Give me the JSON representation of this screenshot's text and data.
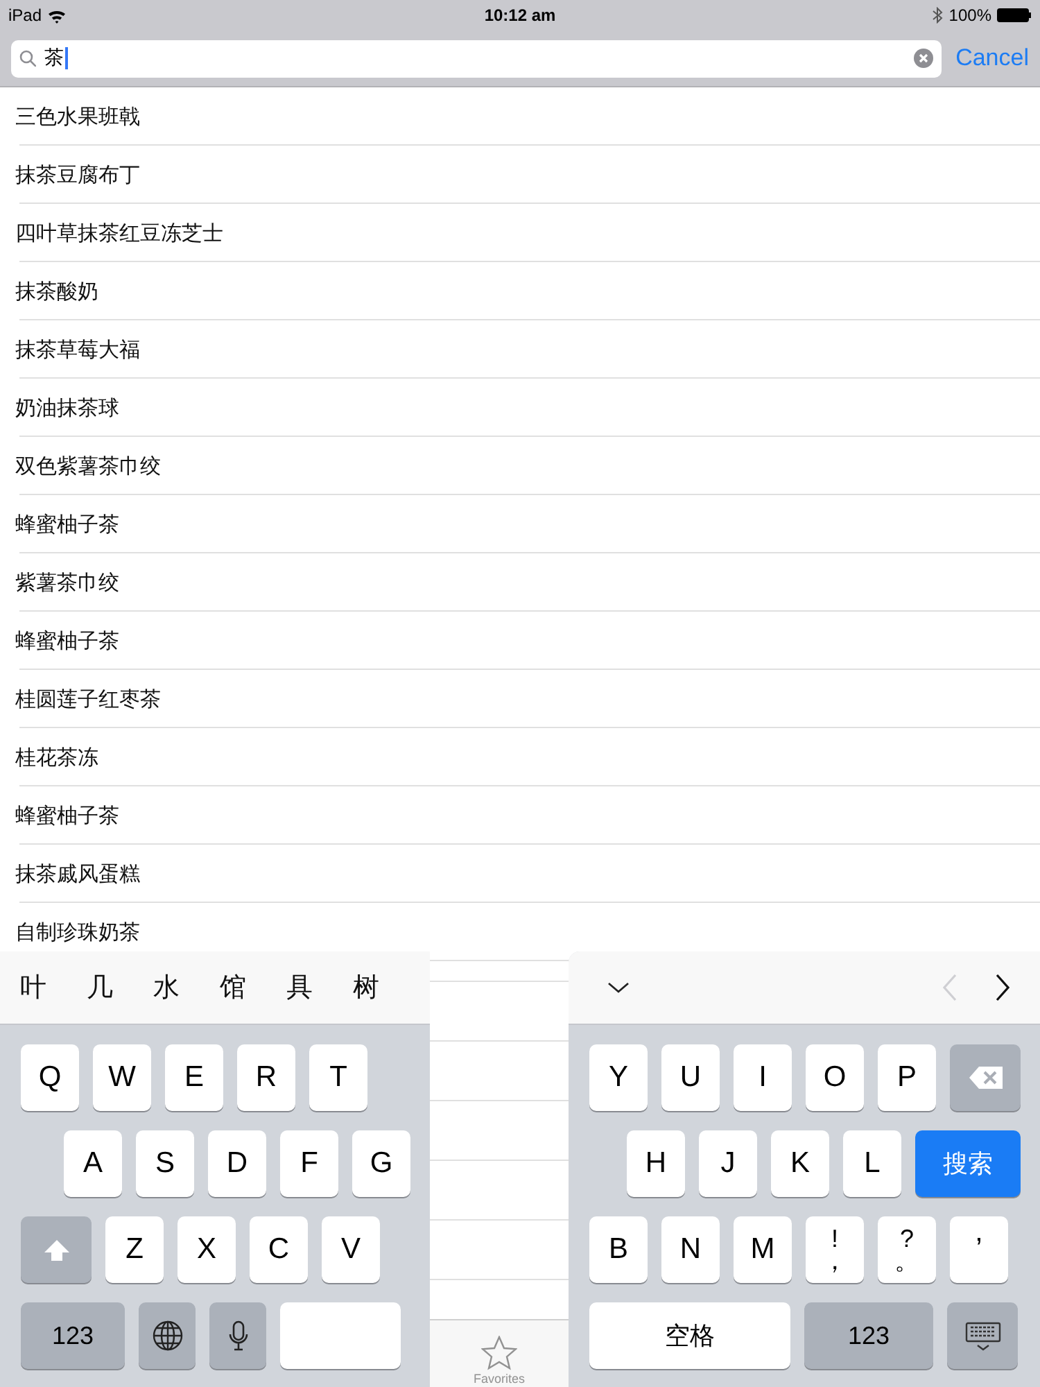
{
  "status_bar": {
    "device": "iPad",
    "time": "10:12 am",
    "battery": "100%"
  },
  "search": {
    "value": "茶",
    "action": "Cancel"
  },
  "results": [
    "三色水果班戟",
    "抹茶豆腐布丁",
    "四叶草抹茶红豆冻芝士",
    "抹茶酸奶",
    "抹茶草莓大福",
    "奶油抹茶球",
    "双色紫薯茶巾绞",
    "蜂蜜柚子茶",
    "紫薯茶巾绞",
    "蜂蜜柚子茶",
    "桂圆莲子红枣茶",
    "桂花茶冻",
    "蜂蜜柚子茶",
    "抹茶戚风蛋糕",
    "自制珍珠奶茶"
  ],
  "tab_bar": {
    "items": [
      {
        "label": "Favorites",
        "selected": false
      }
    ]
  },
  "keyboard": {
    "candidates": [
      "叶",
      "几",
      "水",
      "馆",
      "具",
      "树"
    ],
    "nav": [
      {
        "kind": "prev",
        "disabled": true
      },
      {
        "kind": "next",
        "disabled": false
      }
    ],
    "left_rows": [
      [
        {
          "kind": "char",
          "label": "Q"
        },
        {
          "kind": "char",
          "label": "W"
        },
        {
          "kind": "char",
          "label": "E"
        },
        {
          "kind": "char",
          "label": "R"
        },
        {
          "kind": "char",
          "label": "T"
        }
      ],
      [
        {
          "kind": "char",
          "label": "A"
        },
        {
          "kind": "char",
          "label": "S"
        },
        {
          "kind": "char",
          "label": "D"
        },
        {
          "kind": "char",
          "label": "F"
        },
        {
          "kind": "char",
          "label": "G"
        }
      ],
      [
        {
          "kind": "shift"
        },
        {
          "kind": "char",
          "label": "Z"
        },
        {
          "kind": "char",
          "label": "X"
        },
        {
          "kind": "char",
          "label": "C"
        },
        {
          "kind": "char",
          "label": "V"
        }
      ],
      [
        {
          "kind": "mod",
          "label": "123"
        },
        {
          "kind": "globe"
        },
        {
          "kind": "mic"
        },
        {
          "kind": "blank"
        }
      ]
    ],
    "right_rows": [
      [
        {
          "kind": "char",
          "label": "Y"
        },
        {
          "kind": "char",
          "label": "U"
        },
        {
          "kind": "char",
          "label": "I"
        },
        {
          "kind": "char",
          "label": "O"
        },
        {
          "kind": "char",
          "label": "P"
        },
        {
          "kind": "delete"
        }
      ],
      [
        {
          "kind": "char",
          "label": "H"
        },
        {
          "kind": "char",
          "label": "J"
        },
        {
          "kind": "char",
          "label": "K"
        },
        {
          "kind": "char",
          "label": "L"
        },
        {
          "kind": "action",
          "label": "搜索"
        }
      ],
      [
        {
          "kind": "char",
          "label": "B"
        },
        {
          "kind": "char",
          "label": "N"
        },
        {
          "kind": "char",
          "label": "M"
        },
        {
          "kind": "dual",
          "label": "!",
          "sub": "，"
        },
        {
          "kind": "dual",
          "label": "?",
          "sub": "。"
        },
        {
          "kind": "char",
          "label": "’"
        }
      ],
      [
        {
          "kind": "space",
          "label": "空格"
        },
        {
          "kind": "mod",
          "label": "123"
        },
        {
          "kind": "dismiss"
        }
      ]
    ]
  }
}
